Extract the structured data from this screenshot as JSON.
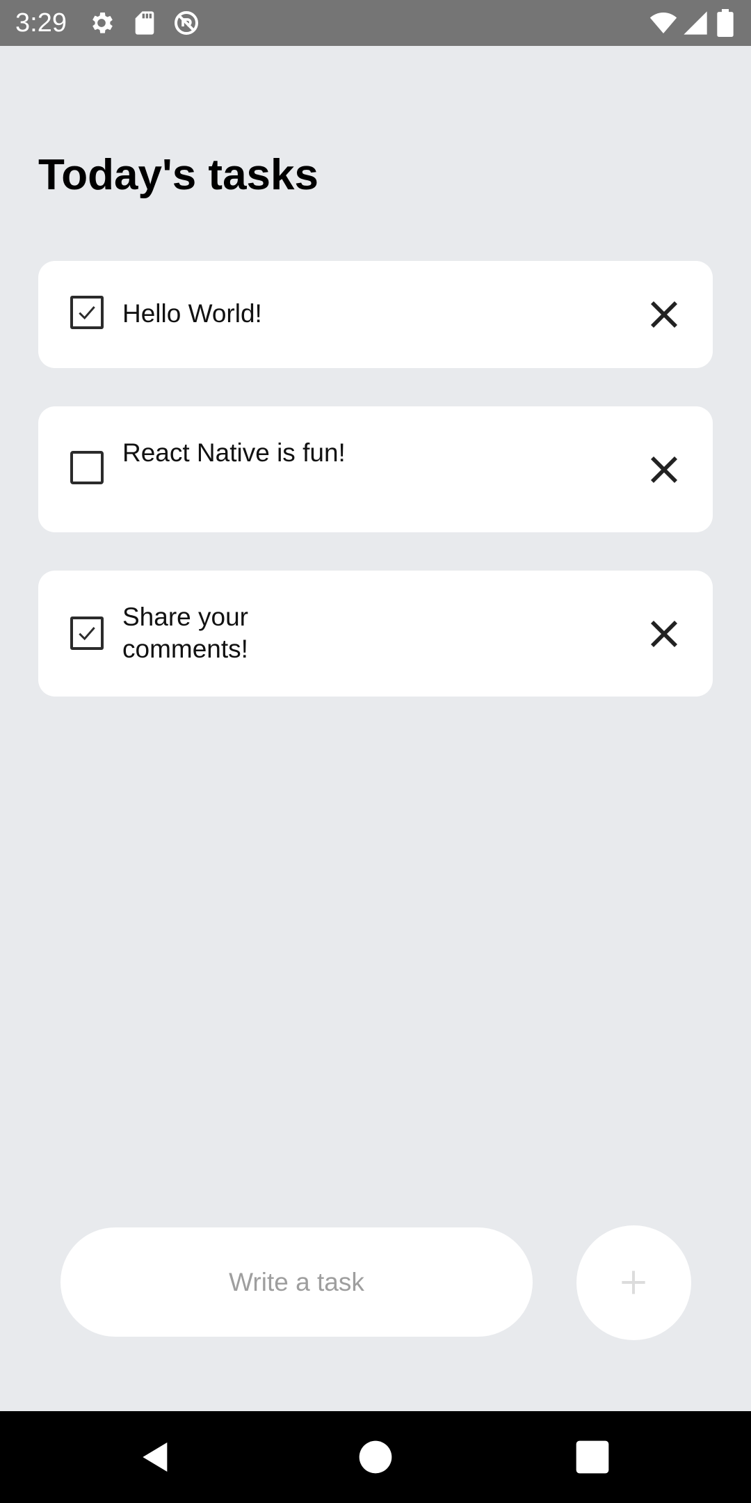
{
  "status_bar": {
    "time": "3:29",
    "left_icons": [
      "gear-icon",
      "sd-card-icon",
      "sync-disabled-icon"
    ],
    "right_icons": [
      "wifi-icon",
      "cell-signal-icon",
      "battery-icon"
    ]
  },
  "page": {
    "title": "Today's tasks"
  },
  "tasks": [
    {
      "text": "Hello World!",
      "checked": true
    },
    {
      "text": "React Native is fun!",
      "checked": false
    },
    {
      "text": "Share your comments!",
      "checked": true
    }
  ],
  "composer": {
    "placeholder": "Write a task",
    "add_icon": "plus-icon"
  },
  "nav_bar": {
    "buttons": [
      "back-icon",
      "home-icon",
      "recents-icon"
    ]
  },
  "colors": {
    "background": "#E8EAED",
    "status_bar": "#757575",
    "card": "#FFFFFF",
    "nav_bar": "#000000"
  }
}
